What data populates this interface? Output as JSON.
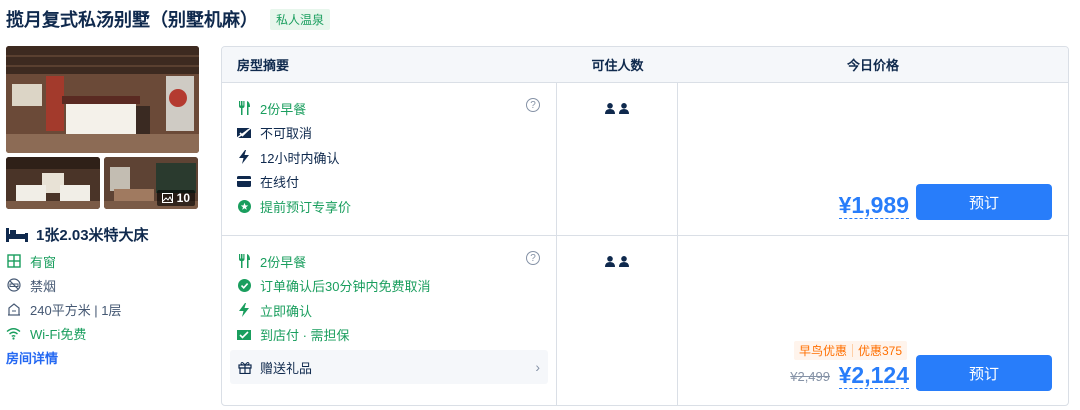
{
  "header": {
    "title": "揽月复式私汤别墅（别墅机麻）",
    "tag": "私人温泉"
  },
  "room": {
    "photo_count": "10",
    "bed": "1张2.03米特大床",
    "facts": [
      {
        "icon": "window-icon",
        "label": "有窗",
        "green": true
      },
      {
        "icon": "no-smoking-icon",
        "label": "禁烟",
        "green": false
      },
      {
        "icon": "area-icon",
        "label": "240平方米 | 1层",
        "green": false
      },
      {
        "icon": "wifi-icon",
        "label": "Wi-Fi免费",
        "green": true
      }
    ],
    "detail_link": "房间详情"
  },
  "table": {
    "headers": [
      "房型摘要",
      "可住人数",
      "今日价格"
    ]
  },
  "rates": [
    {
      "features": [
        {
          "icon": "utensils-icon",
          "label": "2份早餐",
          "green": true
        },
        {
          "icon": "no-cancel-icon",
          "label": "不可取消",
          "green": false
        },
        {
          "icon": "lightning-icon",
          "label": "12小时内确认",
          "green": false
        },
        {
          "icon": "card-icon",
          "label": "在线付",
          "green": false
        },
        {
          "icon": "star-badge-icon",
          "label": "提前预订专享价",
          "green": true
        }
      ],
      "help": "?",
      "price": "¥1,989",
      "book": "预订"
    },
    {
      "features": [
        {
          "icon": "utensils-icon",
          "label": "2份早餐",
          "green": true
        },
        {
          "icon": "check-circle-icon",
          "label": "订单确认后30分钟内免费取消",
          "green": true
        },
        {
          "icon": "lightning-icon",
          "label": "立即确认",
          "green": true
        },
        {
          "icon": "pay-at-hotel-icon",
          "label": "到店付 · 需担保",
          "green": true
        }
      ],
      "help": "?",
      "gift": "赠送礼品",
      "promo": [
        "早鸟优惠",
        "优惠375"
      ],
      "old_price": "¥2,499",
      "price": "¥2,124",
      "book": "预订"
    }
  ],
  "colors": {
    "accent": "#287dfa",
    "green": "#1a9e5e",
    "orange": "#ff6f00",
    "text": "#0f294d"
  }
}
